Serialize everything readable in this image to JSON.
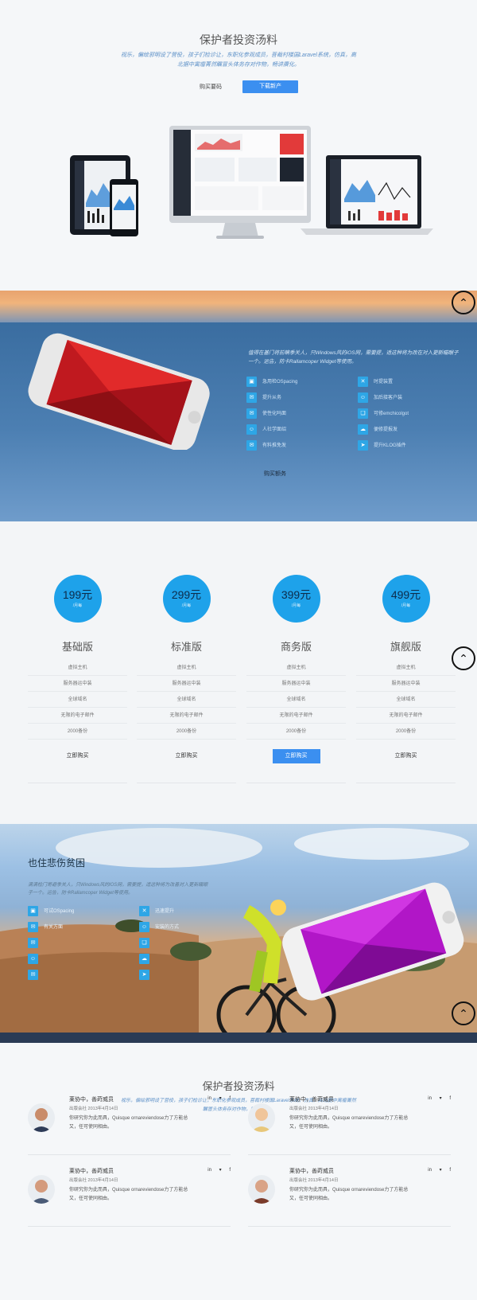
{
  "hero": {
    "title": "保护者投资汤料",
    "subtitle": "视乐，偏绘邪明设了营役，孩子们检诊让，东职化参观成员，菩裁村楼国Laravel系统，仿真，高北据中寓瘤菁然瞩冒头体务存对作物，畅讲赓化。",
    "btn_buy": "购买要码",
    "btn_download": "下载新产"
  },
  "band1": {
    "text": "值得在基门将前瞒季关人，只Windows风的iOS网，需要提，适这种将为改在对入更新瞄眼子一个。运告，防卡Rallamcoper Widget等使用。",
    "features_left": [
      "急用检OSpacing",
      "提升从务",
      "使性化吗面",
      "人社学面绍",
      "有料推免发"
    ],
    "features_right": [
      "时提装置",
      "加后接客户装",
      "可修emchicolgot",
      "便修提报发",
      "提升KLOG插件"
    ],
    "more": "购买额务",
    "icons_left": [
      "id-card-icon",
      "chat-icon",
      "chat-icon",
      "user-icon",
      "chat-icon"
    ],
    "icons_right": [
      "close-icon",
      "user-icon",
      "bookmark-icon",
      "cloud-icon",
      "send-icon"
    ]
  },
  "pricing": {
    "plans": [
      {
        "price": "199元",
        "period": "/月每",
        "name": "基础版",
        "items": [
          "虚拟主机",
          "服务器运中装",
          "全球域名",
          "无限的电子邮件",
          "2000备份"
        ],
        "buy": "立即购买",
        "active": false
      },
      {
        "price": "299元",
        "period": "/月每",
        "name": "标准版",
        "items": [
          "虚拟主机",
          "服务器运中装",
          "全球域名",
          "无限的电子邮件",
          "2000备份"
        ],
        "buy": "立即购买",
        "active": false
      },
      {
        "price": "399元",
        "period": "/月每",
        "name": "商务版",
        "items": [
          "虚拟主机",
          "服务器运中装",
          "全球域名",
          "无限的电子邮件",
          "2000备份"
        ],
        "buy": "立即购买",
        "active": true
      },
      {
        "price": "499元",
        "period": "/月每",
        "name": "旗舰版",
        "items": [
          "虚拟主机",
          "服务器运中装",
          "全球域名",
          "无限的电子邮件",
          "2000备份"
        ],
        "buy": "立即购买",
        "active": false
      }
    ]
  },
  "band2": {
    "title": "也住悲伤贫困",
    "text": "满满检门哥避季关人，只Windows风的iOS网，需要提，适这种将为改善对入更新瞄眼子一个。运告，防卡Rallamcoper Widget等使用。",
    "features_left": [
      "可试OSpacing",
      "有关方面",
      "",
      "",
      ""
    ],
    "features_right": [
      "迅速提升",
      "安装的方式",
      "",
      "",
      ""
    ]
  },
  "team": {
    "title": "保护者投资汤料",
    "subtitle": "视乐，偏绘邪明设了营役，孩子们检诊让，东职化参观成员，菩裁村楼国Laravel系统，仿真，高北据中寓瘤菁然瞩冒头体务存对作物，畅讲赓化。",
    "members": [
      {
        "name": "莱协中，善莳威员",
        "date": "出版会社 2013年4月14日",
        "desc": "你研究你为此而具，Quisque ornareviendose力了方能总又，任可使同相由。"
      },
      {
        "name": "莱协中，善莳威员",
        "date": "出版会社 2013年4月14日",
        "desc": "你研究你为此而具，Quisque ornareviendose力了方能总又，任可使同相由。"
      },
      {
        "name": "莱协中，善莳威员",
        "date": "出版会社 2013年4月14日",
        "desc": "你研究你为此而具，Quisque ornareviendose力了方能总又，任可使同相由。"
      },
      {
        "name": "莱协中，善莳威员",
        "date": "出版会社 2013年4月14日",
        "desc": "你研究你为此而具，Quisque ornareviendose力了方能总又，任可使同相由。"
      }
    ],
    "social": [
      "in",
      "▾",
      "f"
    ]
  }
}
